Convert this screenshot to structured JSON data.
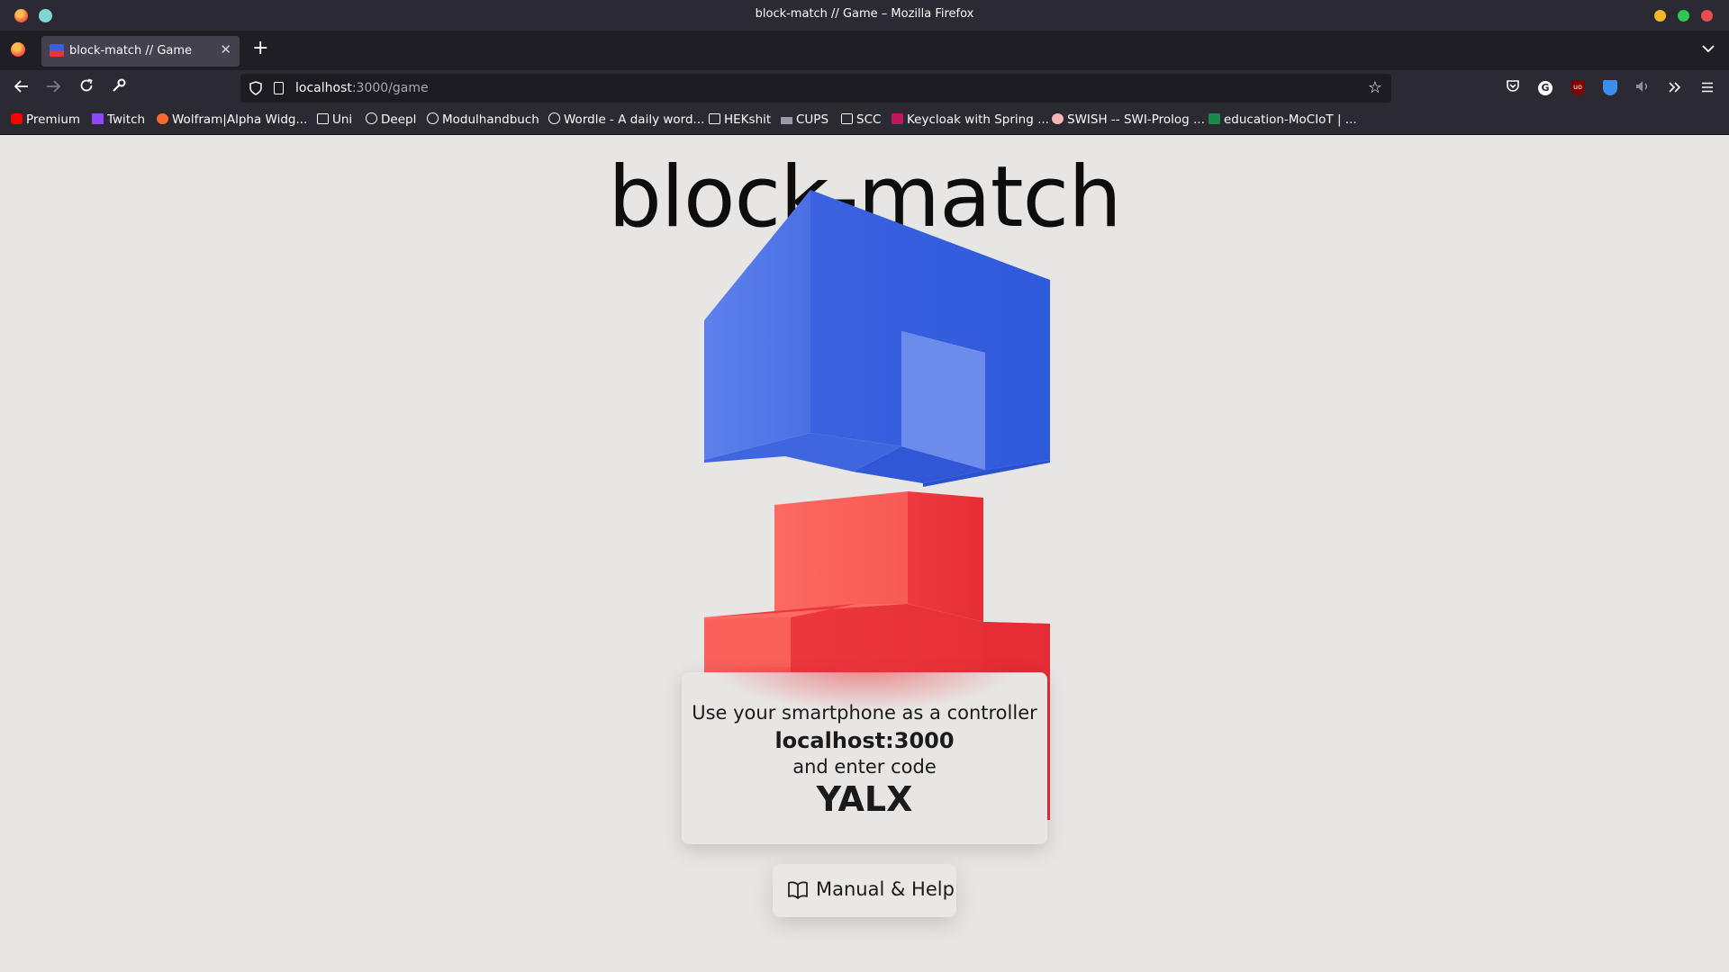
{
  "window": {
    "title": "block-match // Game – Mozilla Firefox"
  },
  "tabs": [
    {
      "title": "block-match // Game",
      "close_glyph": "✕"
    }
  ],
  "navbar": {
    "url_host": "localhost",
    "url_path": ":3000/game"
  },
  "bookmarks": [
    {
      "label": "Premium",
      "icon": "youtube-icon"
    },
    {
      "label": "Twitch",
      "icon": "twitch-icon"
    },
    {
      "label": "Wolfram|Alpha Widg...",
      "icon": "wolfram-icon"
    },
    {
      "label": "Uni",
      "icon": "folder-icon"
    },
    {
      "label": "Deepl",
      "icon": "globe-icon"
    },
    {
      "label": "Modulhandbuch",
      "icon": "globe-icon"
    },
    {
      "label": "Wordle - A daily word...",
      "icon": "globe-icon"
    },
    {
      "label": "HEKshit",
      "icon": "folder-icon"
    },
    {
      "label": "CUPS",
      "icon": "cups-icon"
    },
    {
      "label": "SCC",
      "icon": "folder-icon"
    },
    {
      "label": "Keycloak with Spring ...",
      "icon": "keycloak-icon"
    },
    {
      "label": "SWISH -- SWI-Prolog ...",
      "icon": "swish-icon"
    },
    {
      "label": "education-MoCIoT | ...",
      "icon": "education-icon"
    }
  ],
  "page": {
    "title": "block-match",
    "card": {
      "line1": "Use your smartphone as a controller",
      "host": "localhost:3000",
      "line3": "and enter code",
      "code": "YALX"
    },
    "help_button": "Manual & Help"
  },
  "colors": {
    "blue_block": "#3d66e3",
    "red_block": "#ee3a3d",
    "page_bg": "#e8e6e5",
    "chrome_bg": "#2b2a33"
  }
}
